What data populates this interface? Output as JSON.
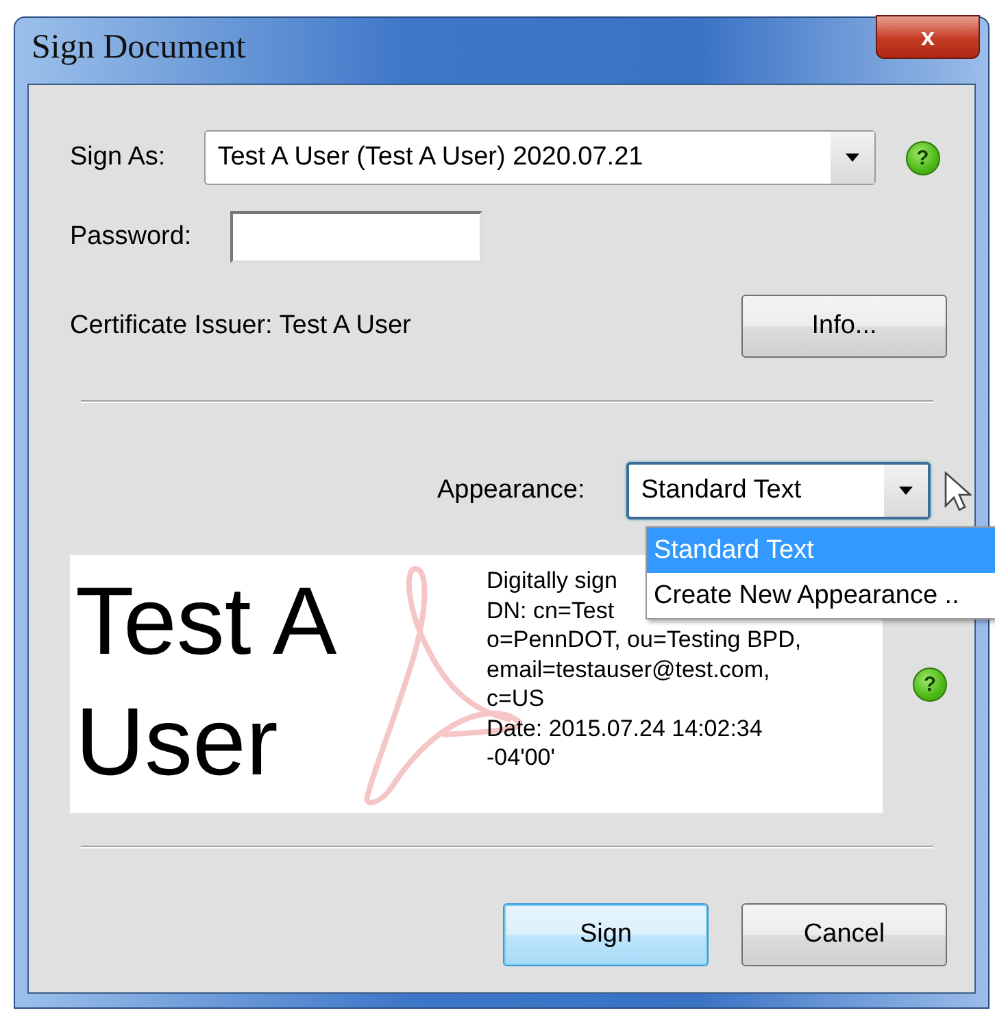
{
  "window": {
    "title": "Sign Document",
    "close_label": "x"
  },
  "sign_as": {
    "label": "Sign As:",
    "value": "Test A User (Test A User) 2020.07.21",
    "help": "?"
  },
  "password": {
    "label": "Password:"
  },
  "certificate_issuer": "Certificate Issuer: Test A User",
  "info_button": "Info...",
  "appearance": {
    "label": "Appearance:",
    "value": "Standard Text",
    "expanded": true,
    "options": [
      {
        "label": "Standard Text",
        "selected": true
      },
      {
        "label": "Create New Appearance ..",
        "selected": false
      }
    ]
  },
  "preview": {
    "help": "?",
    "name_lines": [
      "Test A",
      "User"
    ],
    "detail_lines": [
      "Digitally sign",
      "DN: cn=Test",
      "o=PennDOT, ou=Testing BPD,",
      "email=testauser@test.com,",
      "c=US",
      "Date: 2015.07.24 14:02:34",
      "-04'00'"
    ]
  },
  "buttons": [
    {
      "label": "Sign",
      "default": true
    },
    {
      "label": "Cancel",
      "default": false
    }
  ]
}
